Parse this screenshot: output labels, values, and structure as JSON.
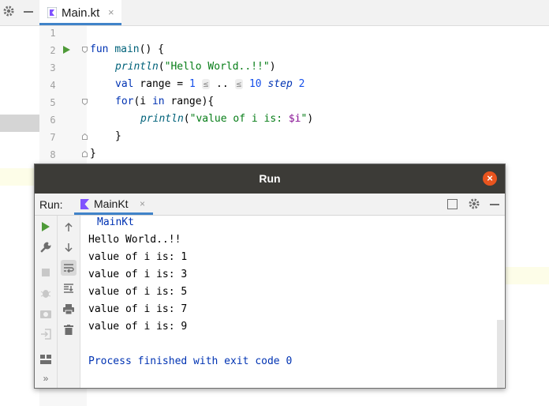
{
  "editor": {
    "tab_label": "Main.kt",
    "tab_close": "×",
    "line_numbers": [
      "1",
      "2",
      "3",
      "4",
      "5",
      "6",
      "7",
      "8"
    ],
    "code": {
      "l2_kw": "fun",
      "l2_fn": "main",
      "l2_rest": "() {",
      "l3_fn": "println",
      "l3_open": "(",
      "l3_str": "\"Hello World..!!\"",
      "l3_close": ")",
      "l4_kw": "val",
      "l4_mid": " range = ",
      "l4_n1": "1",
      "l4_hint1": "≤",
      "l4_dots": "..",
      "l4_hint2": "≤",
      "l4_n2": "10",
      "l4_step": "step",
      "l4_n3": "2",
      "l5_kw": "for",
      "l5_open": "(i ",
      "l5_in": "in",
      "l5_rest": " range){",
      "l6_fn": "println",
      "l6_open": "(",
      "l6_str1": "\"value of i is: ",
      "l6_var": "$i",
      "l6_str2": "\"",
      "l6_close": ")",
      "l7": "}",
      "l8": "}"
    }
  },
  "run_window": {
    "title": "Run",
    "close_glyph": "×",
    "run_label": "Run:",
    "tab_label": "MainKt",
    "tab_close": "×",
    "console": {
      "header": "MainKt",
      "lines": [
        "Hello World..!!",
        "value of i is: 1",
        "value of i is: 3",
        "value of i is: 5",
        "value of i is: 7",
        "value of i is: 9"
      ],
      "exit": "Process finished with exit code 0"
    }
  },
  "icons": {
    "settings": "gear-icon",
    "hide": "minus-icon",
    "rerun": "play-icon",
    "wrench": "wrench-icon",
    "stop": "stop-icon",
    "up": "arrow-up-icon",
    "down": "arrow-down-icon",
    "soft_wrap": "soft-wrap-icon",
    "scroll_end": "scroll-to-end-icon",
    "print": "print-icon",
    "trash": "trash-icon",
    "more": "more-icon"
  },
  "colors": {
    "accent": "#4083c9",
    "title_bar": "#3c3b37",
    "close_button": "#e9541e",
    "run_green": "#4e9a38"
  }
}
